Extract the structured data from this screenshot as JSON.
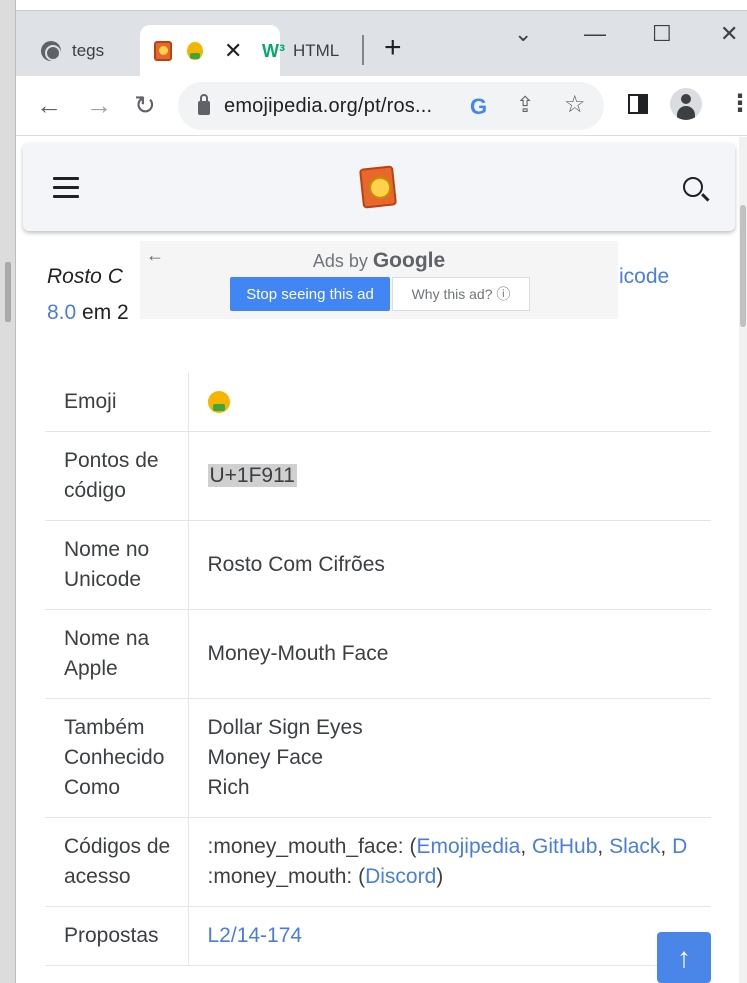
{
  "browser": {
    "tabs": [
      {
        "label": "tegs",
        "icon": "globe-icon"
      },
      {
        "label": "",
        "icon": "emojipedia-favicon",
        "close": "✕"
      },
      {
        "label": "HTML",
        "icon": "w3schools-favicon",
        "badge": "W³"
      }
    ],
    "new_tab": "+",
    "window_controls": {
      "dropdown": "⌄",
      "minimize": "—",
      "maximize": "☐",
      "close": "✕"
    },
    "nav": {
      "back": "←",
      "forward": "→",
      "reload": "↻"
    },
    "url": "emojipedia.org/pt/ros...",
    "menu": "⋮"
  },
  "site": {
    "intro": {
      "left_line1": "Rosto C",
      "right_line1": "icode",
      "left_line2_link": "8.0",
      "left_line2_text": " em 2"
    },
    "ad": {
      "back": "←",
      "ads_by": "Ads by ",
      "google": "Google",
      "stop": "Stop seeing this ad",
      "why": "Why this ad? ⓘ"
    },
    "table": {
      "emoji_label": "Emoji",
      "code_label": "Pontos de código",
      "code_value": "U+1F911",
      "unicode_name_label": "Nome no Unicode",
      "unicode_name_value": "Rosto Com Cifrões",
      "apple_name_label": "Nome na Apple",
      "apple_name_value": "Money-Mouth Face",
      "aka_label": "Também Conhecido Como",
      "aka_values": [
        "Dollar Sign Eyes",
        "Money Face",
        "Rich"
      ],
      "shortcodes_label": "Códigos de acesso",
      "shortcode1_prefix": ":money_mouth_face: (",
      "shortcode1_links": [
        "Emojipedia",
        "GitHub",
        "Slack",
        "D"
      ],
      "shortcode2_prefix": ":money_mouth: (",
      "shortcode2_link": "Discord",
      "shortcode2_suffix": ")",
      "next_label": "Propostas",
      "next_value": "L2/14-174"
    },
    "back_to_top": "↑"
  }
}
